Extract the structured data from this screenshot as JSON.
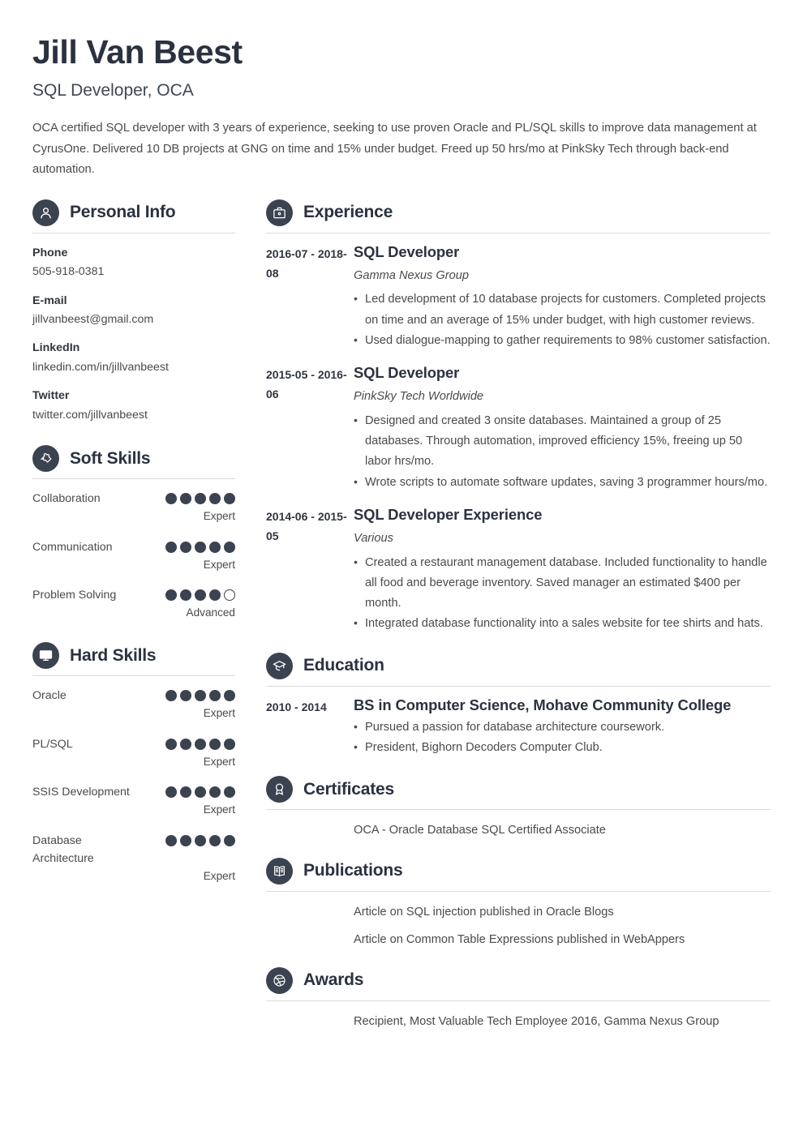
{
  "header": {
    "full_name": "Jill Van Beest",
    "job_title": "SQL Developer, OCA",
    "summary": "OCA certified SQL developer with 3 years of experience, seeking to use proven Oracle and PL/SQL skills to improve data management at CyrusOne. Delivered 10 DB projects at GNG on time and 15% under budget. Freed up 50 hrs/mo at PinkSky Tech through back-end automation."
  },
  "theme": {
    "accent": "#3b4250",
    "heading": "#2a3240",
    "body_text": "#4a4a4a",
    "rule": "#dcdcdc",
    "background": "#ffffff"
  },
  "personal_info": {
    "section_title": "Personal Info",
    "icon": "user-icon",
    "items": [
      {
        "label": "Phone",
        "value": "505-918-0381"
      },
      {
        "label": "E-mail",
        "value": "jillvanbeest@gmail.com"
      },
      {
        "label": "LinkedIn",
        "value": "linkedin.com/in/jillvanbeest"
      },
      {
        "label": "Twitter",
        "value": "twitter.com/jillvanbeest"
      }
    ]
  },
  "soft_skills": {
    "section_title": "Soft Skills",
    "icon": "puzzle-piece-icon",
    "max_dots": 5,
    "items": [
      {
        "name": "Collaboration",
        "filled": 5,
        "level": "Expert"
      },
      {
        "name": "Communication",
        "filled": 5,
        "level": "Expert"
      },
      {
        "name": "Problem Solving",
        "filled": 4,
        "level": "Advanced"
      }
    ]
  },
  "hard_skills": {
    "section_title": "Hard Skills",
    "icon": "monitor-icon",
    "max_dots": 5,
    "items": [
      {
        "name": "Oracle",
        "filled": 5,
        "level": "Expert"
      },
      {
        "name": "PL/SQL",
        "filled": 5,
        "level": "Expert"
      },
      {
        "name": "SSIS Development",
        "filled": 5,
        "level": "Expert"
      },
      {
        "name": "Database Architecture",
        "filled": 5,
        "level": "Expert"
      }
    ]
  },
  "experience": {
    "section_title": "Experience",
    "icon": "briefcase-icon",
    "entries": [
      {
        "dates": "2016-07 - 2018-08",
        "title": "SQL Developer",
        "org": "Gamma Nexus Group",
        "bullets": [
          "Led development of 10 database projects for customers. Completed projects on time and an average of 15% under budget, with high customer reviews.",
          "Used dialogue-mapping to gather requirements to 98% customer satisfaction."
        ]
      },
      {
        "dates": "2015-05 - 2016-06",
        "title": "SQL Developer",
        "org": "PinkSky Tech Worldwide",
        "bullets": [
          "Designed and created 3 onsite databases. Maintained a group of 25 databases. Through automation, improved efficiency 15%, freeing up 50 labor hrs/mo.",
          "Wrote scripts to automate software updates, saving 3 programmer hours/mo."
        ]
      },
      {
        "dates": "2014-06 - 2015-05",
        "title": "SQL Developer Experience",
        "org": "Various",
        "bullets": [
          "Created a restaurant management database. Included functionality to handle all food and beverage inventory. Saved manager an estimated $400 per month.",
          "Integrated database functionality into a sales website for tee shirts and hats."
        ]
      }
    ]
  },
  "education": {
    "section_title": "Education",
    "icon": "graduation-cap-icon",
    "entries": [
      {
        "dates": "2010 - 2014",
        "title": "BS in Computer Science, Mohave Community College",
        "bullets": [
          "Pursued a passion for database architecture coursework.",
          "President, Bighorn Decoders Computer Club."
        ]
      }
    ]
  },
  "certificates": {
    "section_title": "Certificates",
    "icon": "award-ribbon-icon",
    "items": [
      "OCA - Oracle Database SQL Certified Associate"
    ]
  },
  "publications": {
    "section_title": "Publications",
    "icon": "open-book-icon",
    "items": [
      "Article on SQL injection published in Oracle Blogs",
      "Article on Common Table Expressions published in WebAppers"
    ]
  },
  "awards": {
    "section_title": "Awards",
    "icon": "dribbble-ball-icon",
    "items": [
      "Recipient, Most Valuable Tech Employee 2016, Gamma Nexus Group"
    ]
  }
}
